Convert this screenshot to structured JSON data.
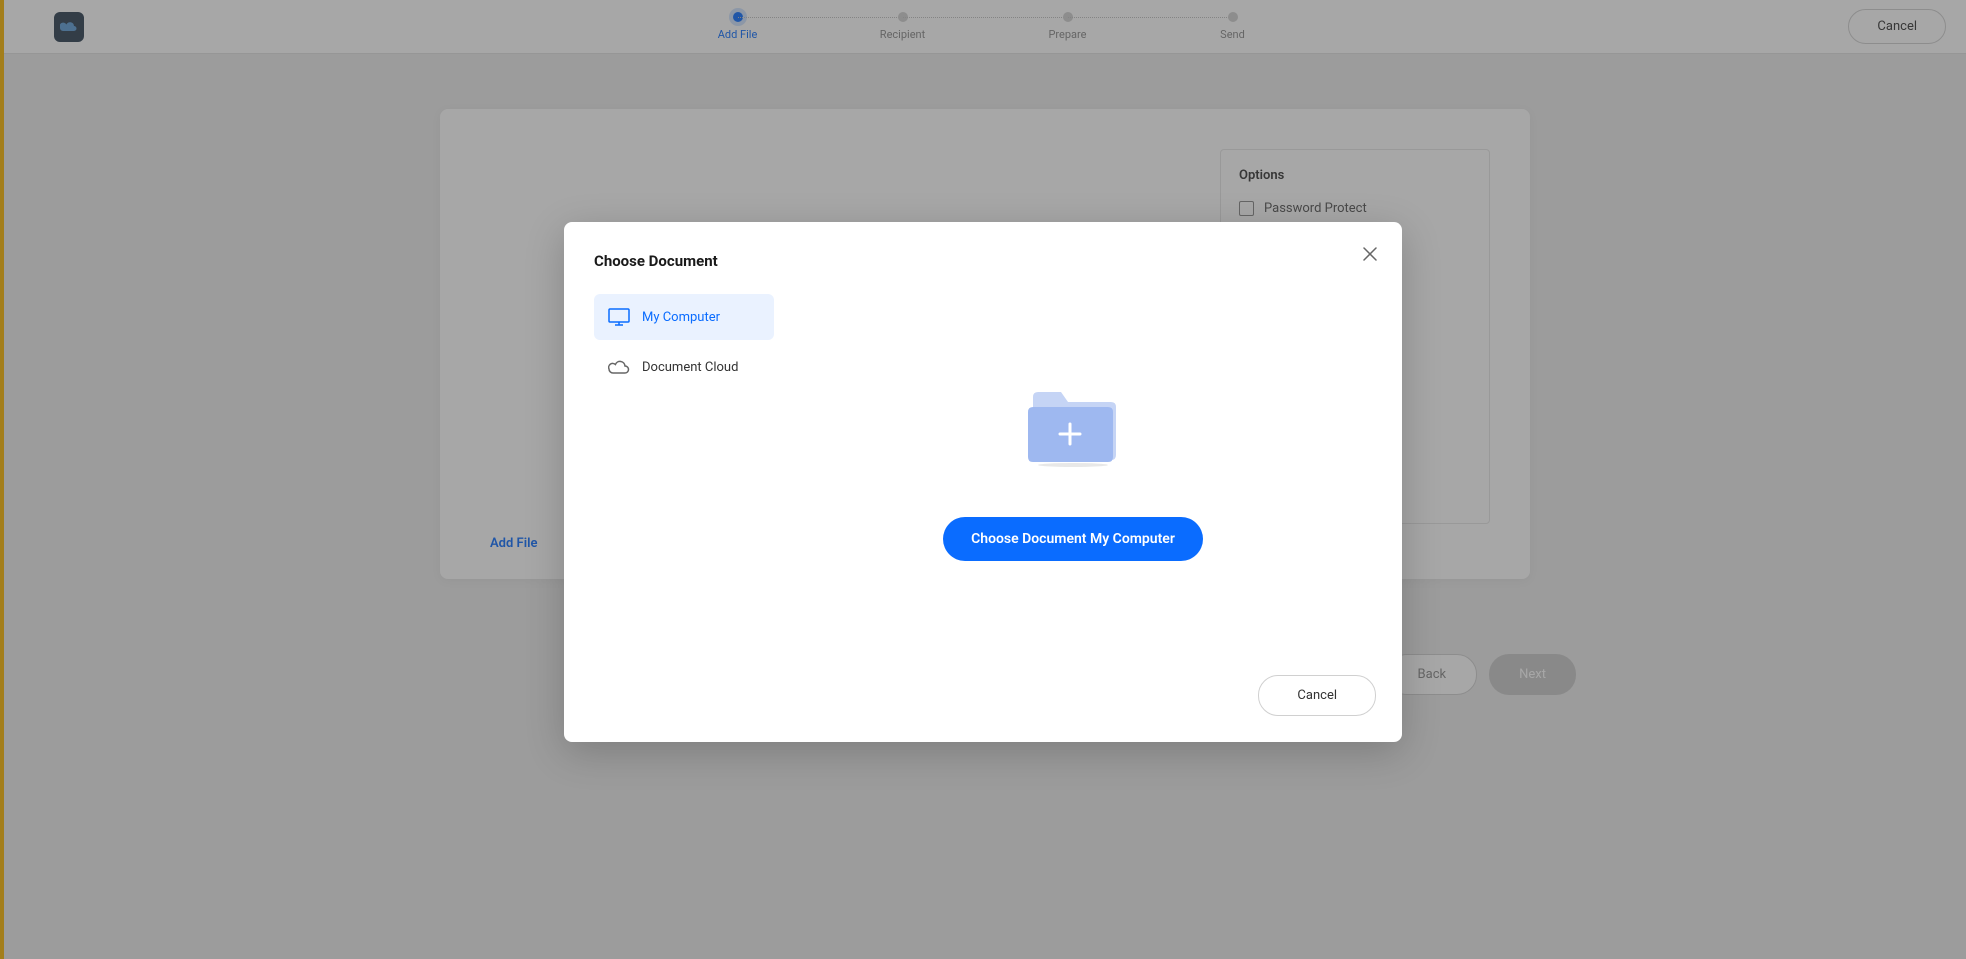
{
  "header": {
    "cancel_label": "Cancel"
  },
  "stepper": {
    "steps": [
      {
        "label": "Add File",
        "active": true
      },
      {
        "label": "Recipient",
        "active": false
      },
      {
        "label": "Prepare",
        "active": false
      },
      {
        "label": "Send",
        "active": false
      }
    ]
  },
  "main": {
    "add_file_label": "Add File",
    "options_title": "Options",
    "password_protect_label": "Password Protect",
    "back_label": "Back",
    "next_label": "Next"
  },
  "modal": {
    "title": "Choose Document",
    "sources": {
      "my_computer": "My Computer",
      "document_cloud": "Document Cloud"
    },
    "choose_button": "Choose Document My Computer",
    "cancel_label": "Cancel"
  },
  "colors": {
    "primary": "#0a6cff",
    "accent": "#f7b500"
  }
}
